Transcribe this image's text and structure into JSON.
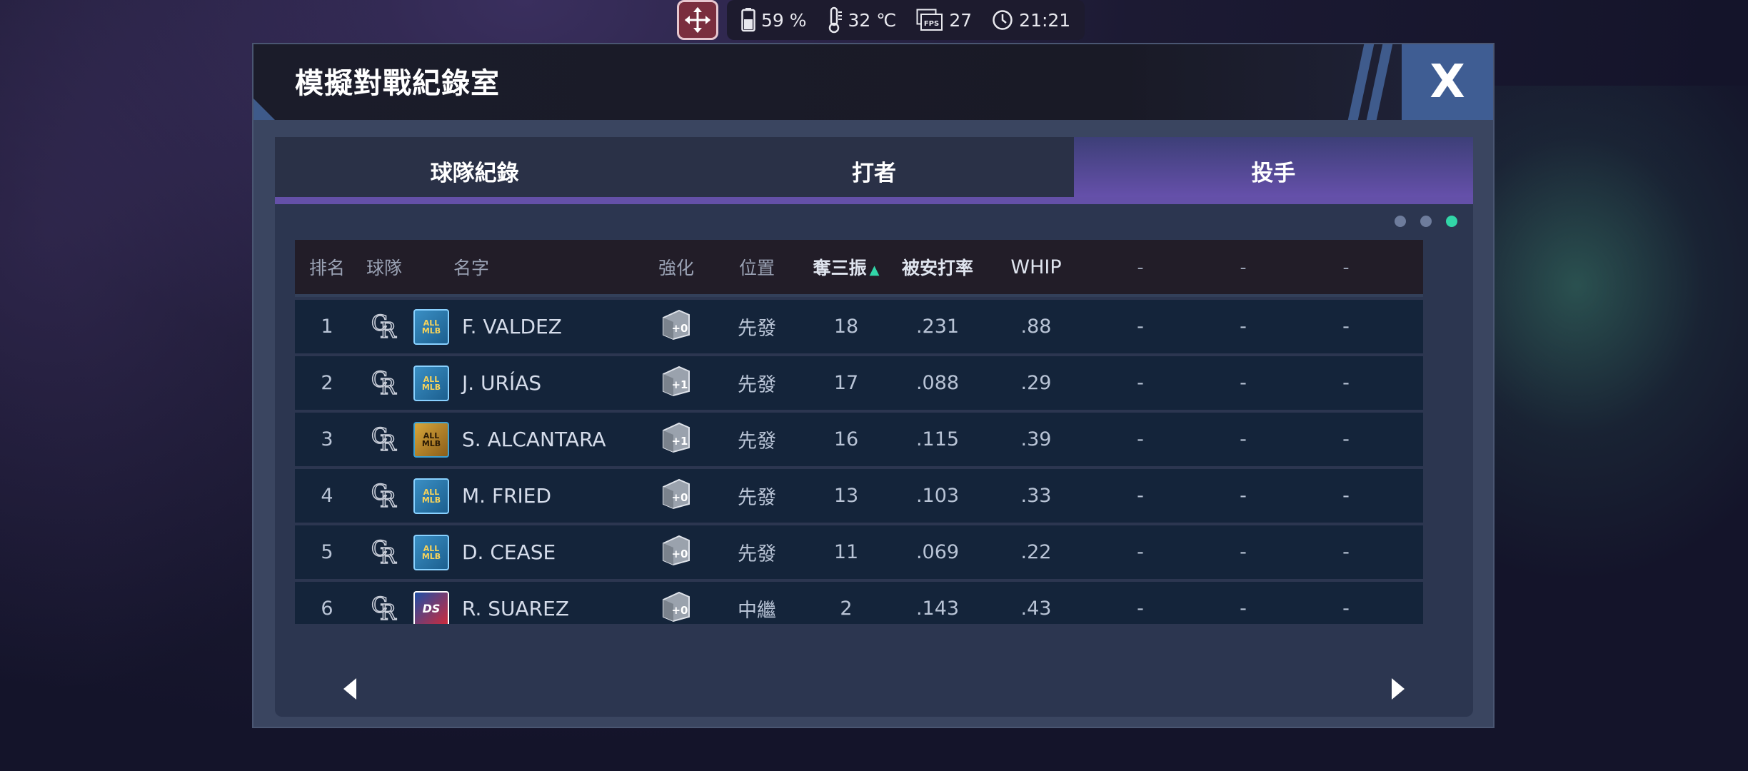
{
  "status": {
    "battery": "59 %",
    "temperature": "32 ℃",
    "fps": "27",
    "time": "21:21"
  },
  "dialog": {
    "title": "模擬對戰紀錄室",
    "close_label": "X"
  },
  "tabs": [
    {
      "label": "球隊紀錄",
      "active": false
    },
    {
      "label": "打者",
      "active": false
    },
    {
      "label": "投手",
      "active": true
    }
  ],
  "pager": {
    "pages": 3,
    "current": 3
  },
  "table": {
    "headers": {
      "rank": "排名",
      "team": "球隊",
      "name": "名字",
      "enhance": "強化",
      "position": "位置",
      "so": "奪三振",
      "ba": "被安打率",
      "whip": "WHIP",
      "d1": "-",
      "d2": "-",
      "d3": "-"
    },
    "rows": [
      {
        "rank": "1",
        "card": "allmlb",
        "name": "F. VALDEZ",
        "enhance": "+0",
        "position": "先發",
        "so": "18",
        "ba": ".231",
        "whip": ".88",
        "d1": "-",
        "d2": "-",
        "d3": "-"
      },
      {
        "rank": "2",
        "card": "allmlb",
        "name": "J. URÍAS",
        "enhance": "+1",
        "position": "先發",
        "so": "17",
        "ba": ".088",
        "whip": ".29",
        "d1": "-",
        "d2": "-",
        "d3": "-"
      },
      {
        "rank": "3",
        "card": "gold",
        "name": "S. ALCANTARA",
        "enhance": "+1",
        "position": "先發",
        "so": "16",
        "ba": ".115",
        "whip": ".39",
        "d1": "-",
        "d2": "-",
        "d3": "-"
      },
      {
        "rank": "4",
        "card": "allmlb",
        "name": "M. FRIED",
        "enhance": "+0",
        "position": "先發",
        "so": "13",
        "ba": ".103",
        "whip": ".33",
        "d1": "-",
        "d2": "-",
        "d3": "-"
      },
      {
        "rank": "5",
        "card": "allmlb",
        "name": "D. CEASE",
        "enhance": "+0",
        "position": "先發",
        "so": "11",
        "ba": ".069",
        "whip": ".22",
        "d1": "-",
        "d2": "-",
        "d3": "-"
      },
      {
        "rank": "6",
        "card": "ds",
        "name": "R. SUAREZ",
        "enhance": "+0",
        "position": "中繼",
        "so": "2",
        "ba": ".143",
        "whip": ".43",
        "d1": "-",
        "d2": "-",
        "d3": "-"
      }
    ]
  },
  "card_labels": {
    "allmlb": "ALL MLB",
    "gold": "ALL MLB",
    "ds": "DS"
  },
  "team_logo_text": "CR",
  "colors": {
    "accent": "#32d6a8",
    "tab_active": "#6a52b0",
    "close": "#3f5d93",
    "move_button": "#7a2e3e"
  }
}
